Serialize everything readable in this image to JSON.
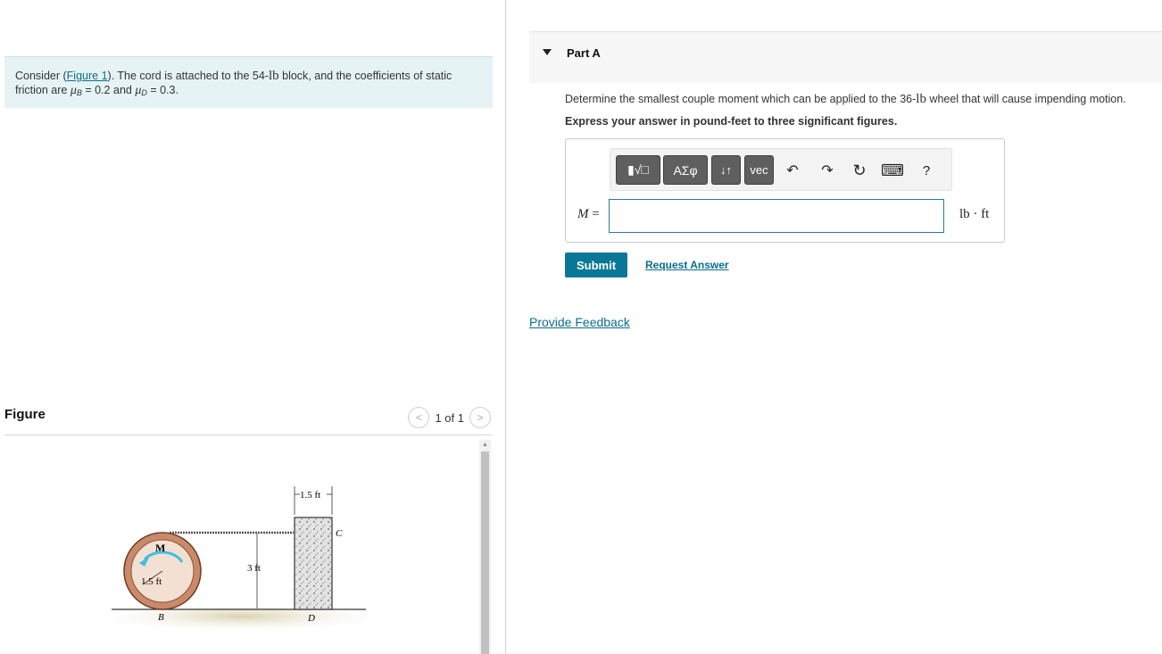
{
  "problem": {
    "text_before_link": "Consider (",
    "figure_link": "Figure 1",
    "text_after_link": "). The cord is attached to the 54-",
    "weight_unit": "lb",
    "text_block_suffix": " block, and the coefficients of static friction are ",
    "mu_symbol": "μ",
    "mu_b_sub": "B",
    "mu_b_value": " = 0.2 and ",
    "mu_d_sub": "D",
    "mu_d_value": " = 0.3."
  },
  "figure": {
    "title": "Figure",
    "pager_text": "1 of 1",
    "prev_glyph": "<",
    "next_glyph": ">",
    "labels": {
      "width_dim": "1.5 ft",
      "corner_c": "C",
      "moment": "M",
      "radius": "1.5 ft",
      "height_dim": "3 ft",
      "point_b": "B",
      "point_d": "D"
    }
  },
  "part": {
    "title": "Part A",
    "question_prefix": "Determine the smallest couple moment which can be applied to the 36-",
    "question_unit": "lb",
    "question_suffix": " wheel that will cause impending motion.",
    "instruction": "Express your answer in pound-feet to three significant figures."
  },
  "toolbar": {
    "templates_label": "▮√□",
    "greek_label": "ΑΣφ",
    "arrows_label": "↓↑",
    "vec_label": "vec",
    "undo_icon": "↶",
    "redo_icon": "↷",
    "reset_icon": "↻",
    "keyboard_icon": "⌨",
    "help_label": "?"
  },
  "answer": {
    "var_label": "M",
    "equals": " =",
    "value": "",
    "unit": "lb · ft"
  },
  "actions": {
    "submit": "Submit",
    "request_answer": "Request Answer",
    "feedback": "Provide Feedback"
  },
  "colors": {
    "accent": "#0b7797",
    "link": "#0b6d8c",
    "problem_bg": "#e6f3f5",
    "wheel": "#c98a6a",
    "moment_arrow": "#3cc0e0"
  }
}
